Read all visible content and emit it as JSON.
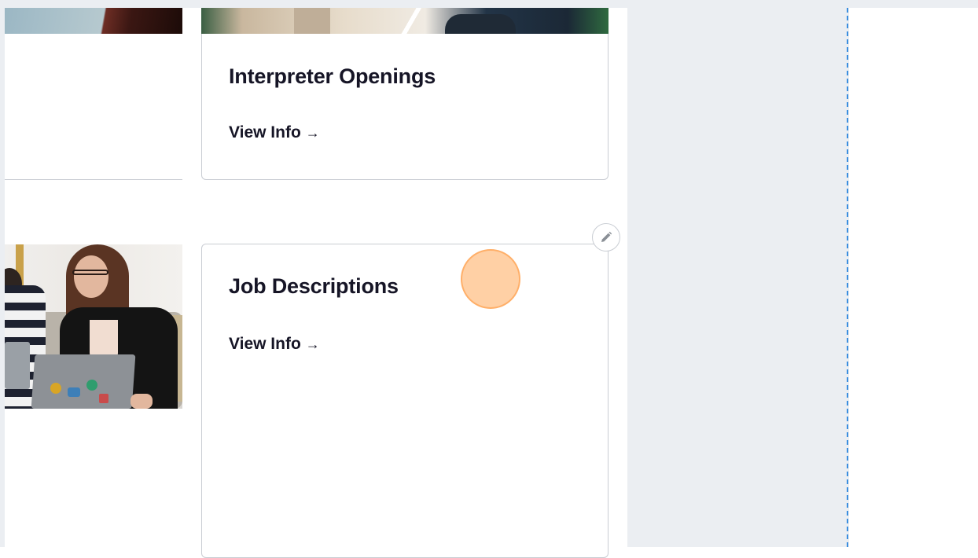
{
  "cards": [
    {
      "title": "Interpreter Openings",
      "link_label": "View Info",
      "link_arrow": "→"
    },
    {
      "title": "Job Descriptions",
      "link_label": "View Info",
      "link_arrow": "→"
    }
  ],
  "icons": {
    "edit": "pencil-icon",
    "link_arrow": "arrow-right-icon"
  },
  "colors": {
    "panel_bg": "#ebeef2",
    "guide_line": "#3b8ee0",
    "text": "#161526",
    "card_border": "#c9cdd3",
    "click_marker": "#ffbe82"
  }
}
